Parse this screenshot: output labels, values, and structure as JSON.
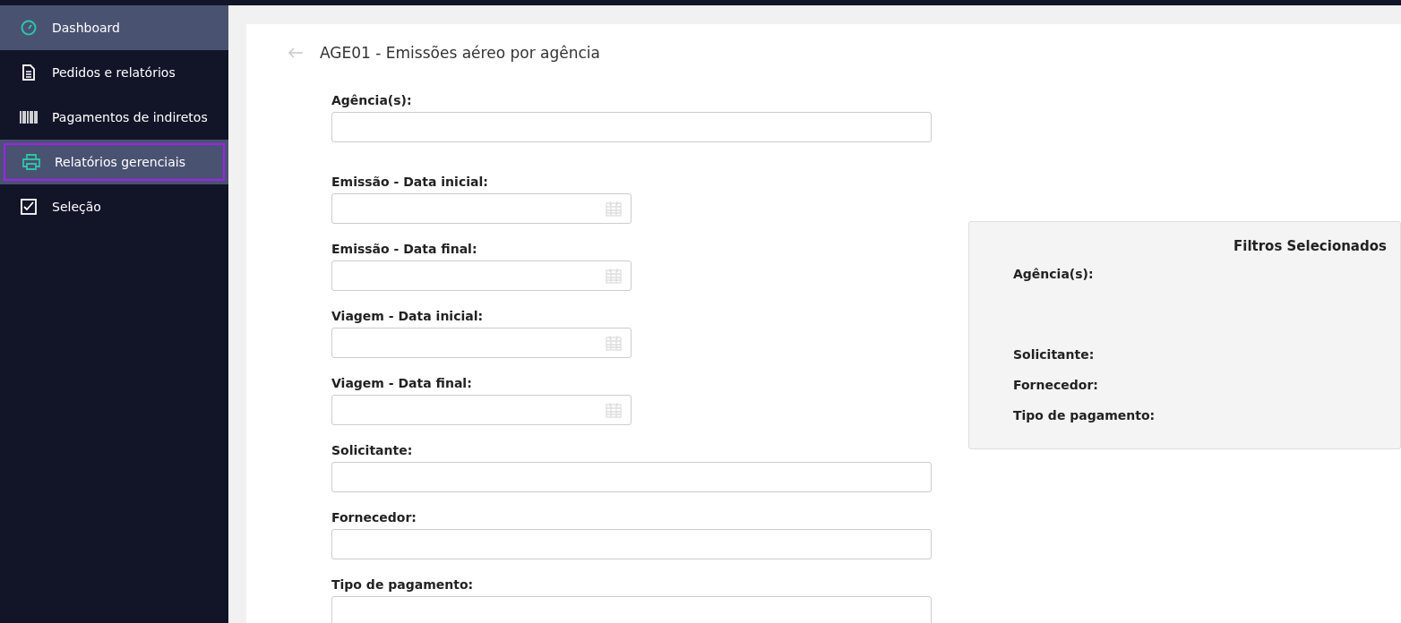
{
  "sidebar": {
    "items": [
      {
        "label": "Dashboard",
        "selected": true,
        "focused": false
      },
      {
        "label": "Pedidos e relatórios",
        "selected": false,
        "focused": false
      },
      {
        "label": "Pagamentos de indiretos",
        "selected": false,
        "focused": false
      },
      {
        "label": "Relatórios gerenciais",
        "selected": true,
        "focused": true
      },
      {
        "label": "Seleção",
        "selected": false,
        "focused": false
      }
    ]
  },
  "page": {
    "title": "AGE01 - Emissões aéreo por agência"
  },
  "form": {
    "fields": [
      {
        "label": "Agência(s):",
        "kind": "text"
      },
      {
        "label": "Emissão - Data inicial:",
        "kind": "date"
      },
      {
        "label": "Emissão - Data final:",
        "kind": "date"
      },
      {
        "label": "Viagem - Data inicial:",
        "kind": "date"
      },
      {
        "label": "Viagem - Data final:",
        "kind": "date"
      },
      {
        "label": "Solicitante:",
        "kind": "text"
      },
      {
        "label": "Fornecedor:",
        "kind": "text"
      },
      {
        "label": "Tipo de pagamento:",
        "kind": "text"
      }
    ]
  },
  "summary": {
    "title": "Filtros Selecionados",
    "items": [
      "Agência(s):",
      "Solicitante:",
      "Fornecedor:",
      "Tipo de pagamento:"
    ]
  }
}
